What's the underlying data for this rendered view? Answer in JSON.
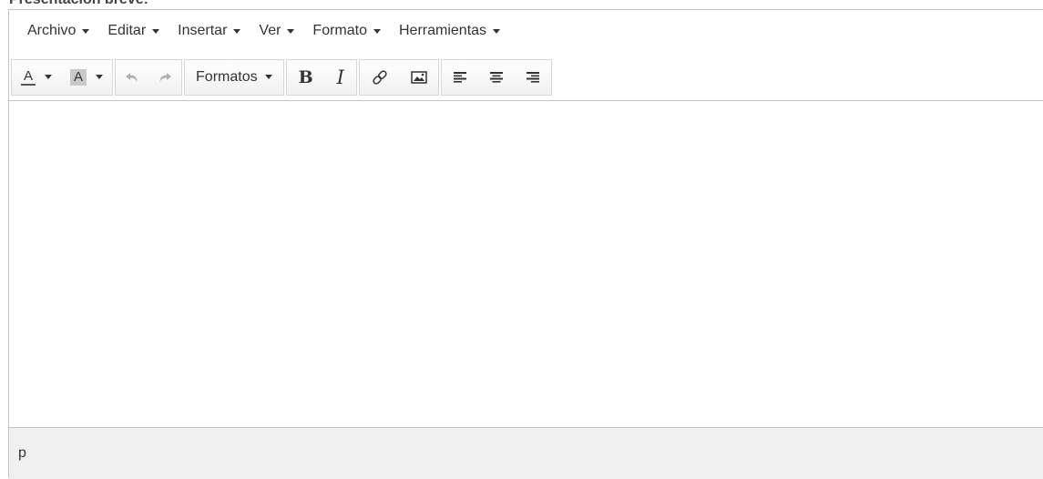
{
  "field_label": "Presentación breve:",
  "menubar": {
    "items": [
      {
        "label": "Archivo"
      },
      {
        "label": "Editar"
      },
      {
        "label": "Insertar"
      },
      {
        "label": "Ver"
      },
      {
        "label": "Formato"
      },
      {
        "label": "Herramientas"
      }
    ]
  },
  "toolbar": {
    "text_color_letter": "A",
    "bg_color_letter": "A",
    "formats_label": "Formatos",
    "bold_letter": "B",
    "italic_letter": "I",
    "icons": [
      "undo-icon",
      "redo-icon",
      "link-icon",
      "image-icon",
      "align-left-icon",
      "align-center-icon",
      "align-right-icon"
    ]
  },
  "statusbar": {
    "path": "p"
  }
}
